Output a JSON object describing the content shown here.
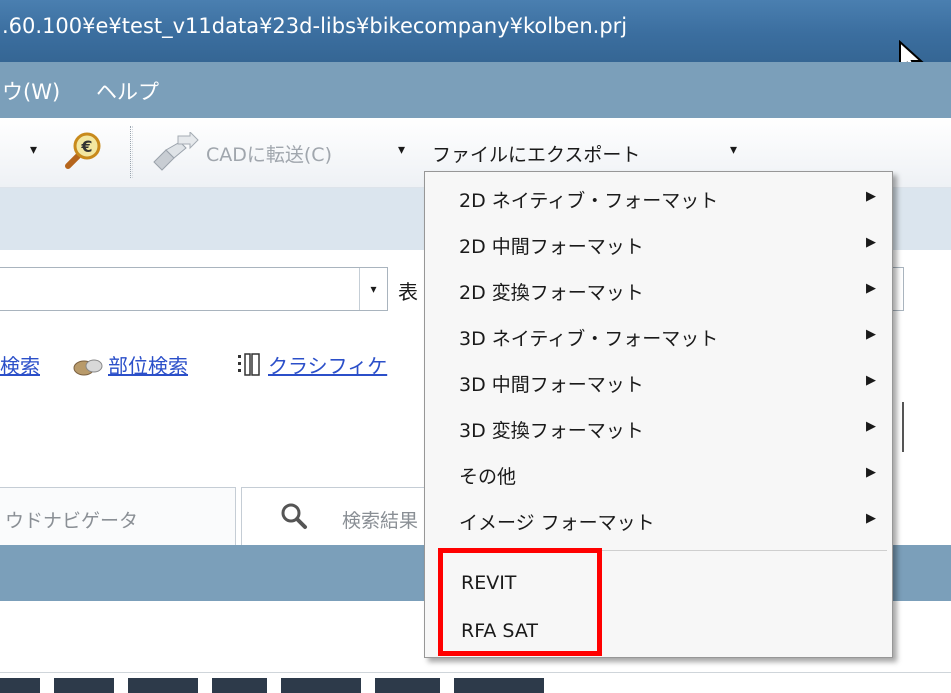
{
  "window": {
    "title": ".60.100¥e¥test_v11data¥23d-libs¥bikecompany¥kolben.prj"
  },
  "menubar": {
    "items": [
      "ウ(W)",
      "ヘルプ"
    ]
  },
  "toolbar": {
    "cad_transfer_label": "CADに転送(C)",
    "file_export_label": "ファイルにエクスポート",
    "dropdown_arrow": "▾",
    "price_icon_glyph": "€"
  },
  "search": {
    "side_label": "表"
  },
  "links": {
    "search_label": "検索",
    "part_search_label": "部位検索",
    "classification_label": "クラシフィケ"
  },
  "tabs": {
    "navigator_label": "ウドナビゲータ",
    "search_results_label": "検索結果"
  },
  "export_menu": {
    "items": [
      {
        "label": "2D ネイティブ・フォーマット",
        "has_submenu": true
      },
      {
        "label": "2D 中間フォーマット",
        "has_submenu": true
      },
      {
        "label": "2D 変換フォーマット",
        "has_submenu": true
      },
      {
        "label": "3D ネイティブ・フォーマット",
        "has_submenu": true
      },
      {
        "label": "3D 中間フォーマット",
        "has_submenu": true
      },
      {
        "label": "3D 変換フォーマット",
        "has_submenu": true
      },
      {
        "label": "その他",
        "has_submenu": true
      },
      {
        "label": "イメージ フォーマット",
        "has_submenu": true
      }
    ],
    "extra_items": [
      {
        "label": "REVIT"
      },
      {
        "label": "RFA SAT"
      }
    ],
    "submenu_arrow": "▶"
  },
  "colors": {
    "title_bar": "#3b6e9f",
    "menu_bar": "#7b9fba",
    "highlight_box": "#ff0000",
    "link": "#2b4fc9"
  }
}
